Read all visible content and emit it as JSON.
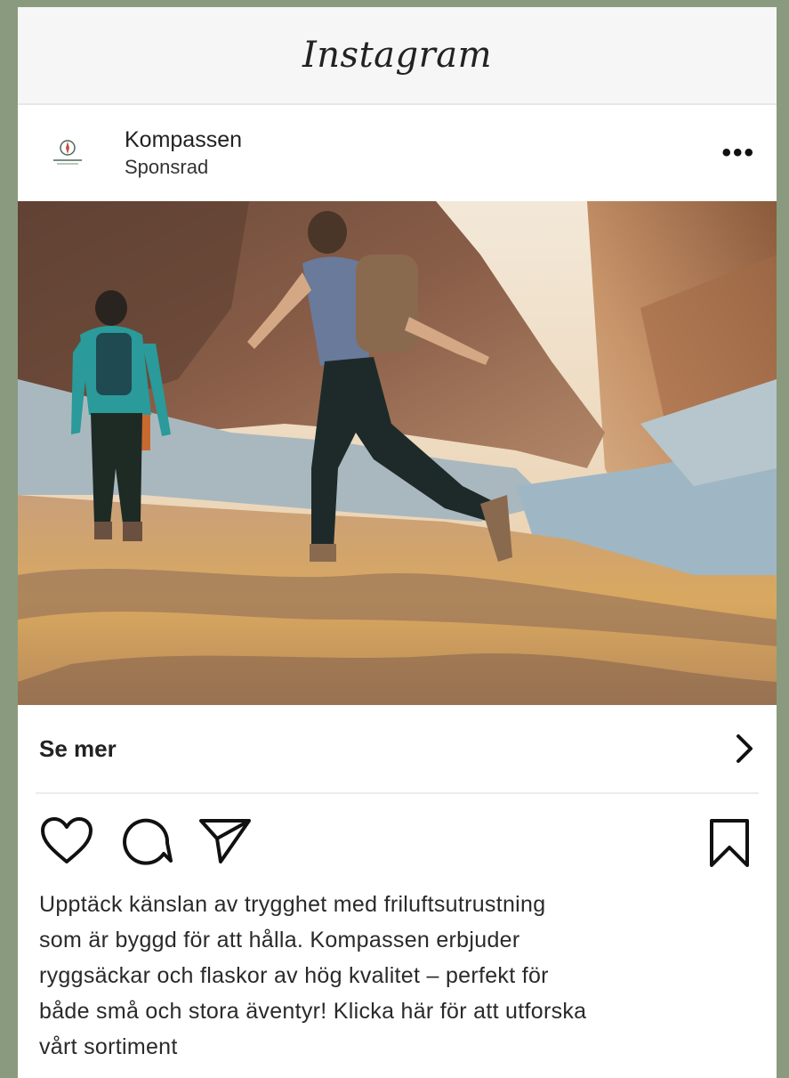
{
  "app": {
    "title": "Instagram"
  },
  "post": {
    "account_name": "Kompassen",
    "sponsored_label": "Sponsrad",
    "more_label": "•••",
    "image_icon": "hikers-canyon-photo"
  },
  "cta": {
    "label": "Se mer",
    "icon": "chevron-right-icon"
  },
  "actions": {
    "like_icon": "heart-icon",
    "comment_icon": "comment-icon",
    "share_icon": "send-icon",
    "save_icon": "bookmark-icon"
  },
  "caption": {
    "lines": [
      "Upptäck känslan av trygghet med friluftsutrustning",
      "som är byggd för att hålla. Kompassen erbjuder",
      "ryggsäckar och flaskor av hög kvalitet – perfekt för",
      "både små och stora äventyr! Klicka här för att utforska",
      "vårt sortiment"
    ]
  },
  "colors": {
    "background": "#8a9a7e",
    "card": "#ffffff",
    "topbar": "#f6f6f6"
  }
}
